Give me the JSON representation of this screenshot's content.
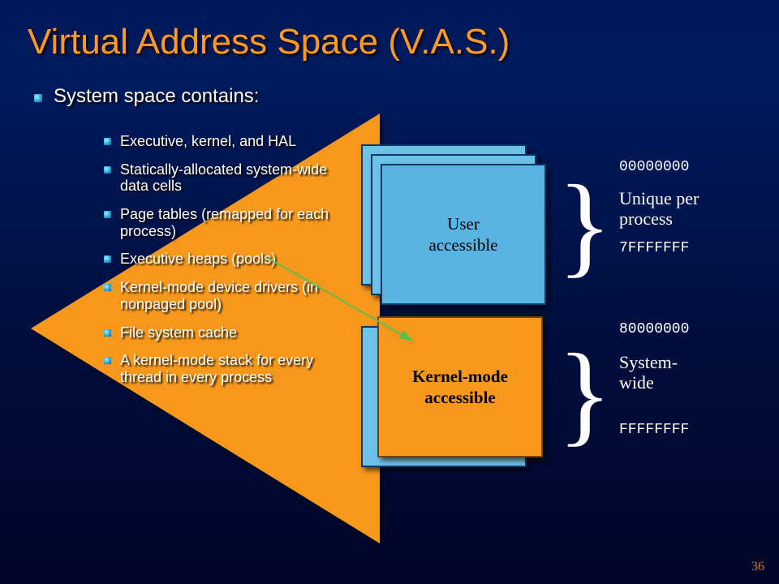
{
  "title": "Virtual Address Space (V.A.S.)",
  "subhead": "System space contains:",
  "bullets": [
    "Executive, kernel, and HAL",
    "Statically-allocated system-wide data cells",
    "Page tables (remapped for each process)",
    "Executive heaps (pools)",
    "Kernel-mode device drivers (in nonpaged pool)",
    "File system cache",
    "A kernel-mode stack for every  thread in every process"
  ],
  "diagram": {
    "user_box": "User\naccessible",
    "kernel_box": "Kernel-mode\naccessible",
    "addr_user_start": "00000000",
    "addr_user_end": "7FFFFFFF",
    "addr_kernel_start": "80000000",
    "addr_kernel_end": "FFFFFFFF",
    "label_user": "Unique per\nprocess",
    "label_kernel": "System-\nwide"
  },
  "page_number": "36"
}
